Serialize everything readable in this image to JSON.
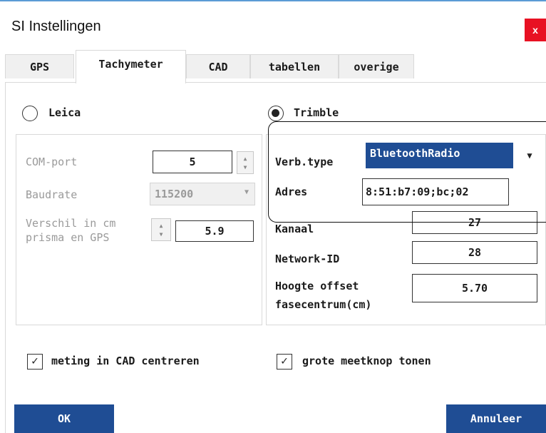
{
  "window": {
    "title": "SI Instellingen",
    "close_label": "x"
  },
  "tabs": [
    {
      "label": "GPS"
    },
    {
      "label": "Tachymeter"
    },
    {
      "label": "CAD"
    },
    {
      "label": "tabellen"
    },
    {
      "label": "overige"
    }
  ],
  "leica": {
    "label": "Leica",
    "selected": false,
    "com_port_label": "COM-port",
    "com_port_value": "5",
    "baudrate_label": "Baudrate",
    "baudrate_value": "115200",
    "verschil_label_1": "Verschil in cm",
    "verschil_label_2": "prisma en GPS",
    "verschil_value": "5.9"
  },
  "trimble": {
    "label": "Trimble",
    "selected": true,
    "verb_type_label": "Verb.type",
    "verb_type_value": "BluetoothRadio",
    "adres_label": "Adres",
    "adres_value": "8:51:b7:09;bc;02",
    "kanaal_label": "Kanaal",
    "kanaal_value": "27",
    "network_id_label": "Network-ID",
    "network_id_value": "28",
    "hoogte_label_1": "Hoogte offset",
    "hoogte_label_2": "fasecentrum(cm)",
    "hoogte_value": "5.70"
  },
  "options": {
    "meting_cad": {
      "label": "meting in CAD centreren",
      "checked": true
    },
    "grote_meetknop": {
      "label": "grote meetknop tonen",
      "checked": true
    }
  },
  "buttons": {
    "ok": "OK",
    "annuleer": "Annuleer"
  },
  "colors": {
    "accent": "#1f4d94",
    "close": "#e81123",
    "disabled_text": "#9a9a9a"
  }
}
